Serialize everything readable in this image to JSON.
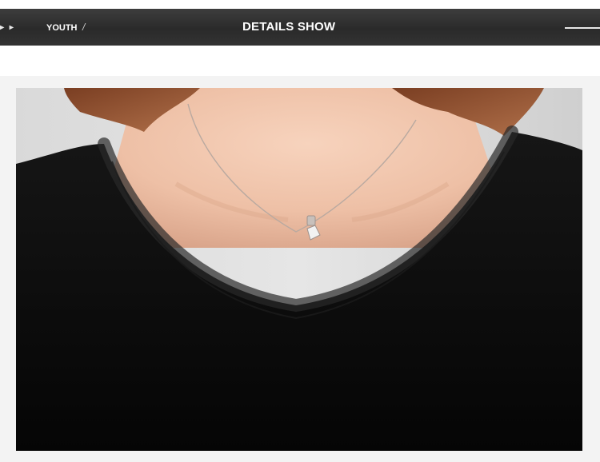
{
  "breadcrumb": {
    "arrows": "▸ ▸",
    "current": "YOUTH",
    "separator": "/"
  },
  "header": {
    "title": "DETAILS SHOW"
  },
  "colors": {
    "banner": "#2e2e2e",
    "shirt": "#0d0d0d",
    "skin": "#f0c4aa",
    "hair": "#9a5a3a",
    "background": "#f3f3f3"
  },
  "photo": {
    "subject": "neckline-detail",
    "icons": [
      "necklace-icon"
    ]
  }
}
